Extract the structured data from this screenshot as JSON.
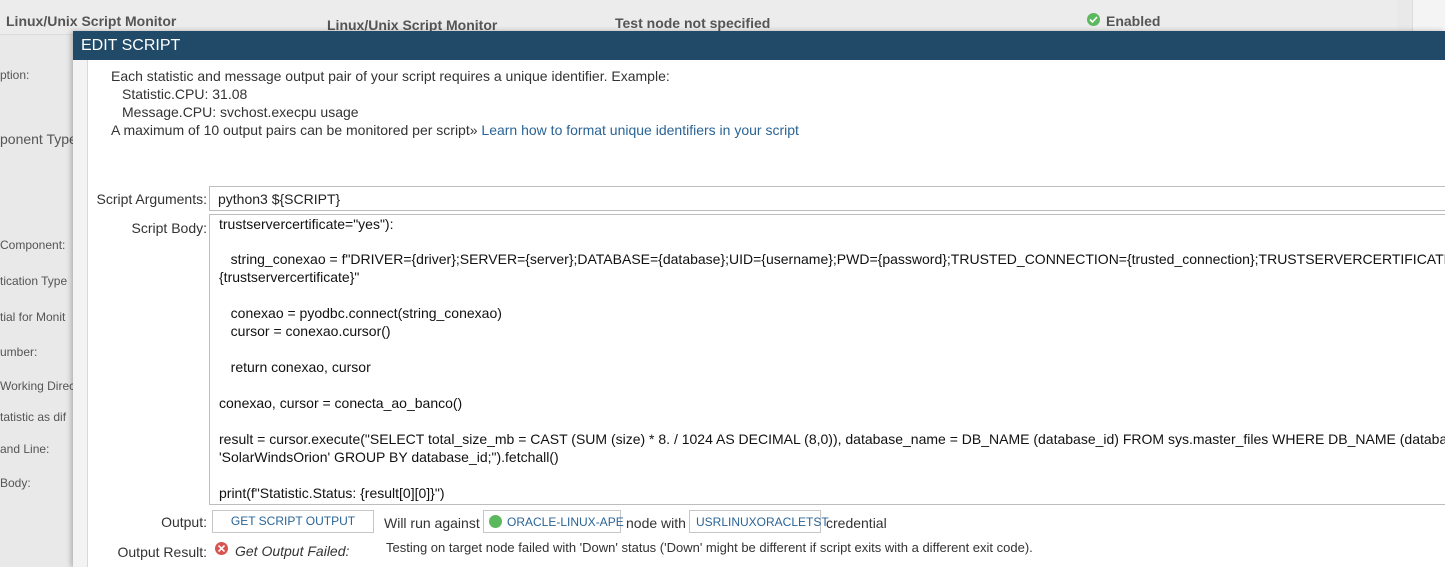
{
  "background": {
    "row": {
      "name": "Linux/Unix Script Monitor",
      "type": "Linux/Unix Script Monitor",
      "test_node": "Test node not specified",
      "status": "Enabled"
    },
    "labels": [
      "ption:",
      "ponent Type:",
      "Component:",
      "tication Type",
      "tial for Monit",
      "umber:",
      "Working Direc",
      "tatistic as dif",
      "and Line:",
      "Body:"
    ]
  },
  "modal": {
    "title": "EDIT SCRIPT",
    "info": {
      "line1": "Each statistic and message output pair of your script requires a unique identifier. Example:",
      "line2": "Statistic.CPU: 31.08",
      "line3": "Message.CPU: svchost.execpu usage",
      "line4": "A maximum of 10 output pairs can be monitored per script»",
      "link": "Learn how to format unique identifiers in your script"
    },
    "script_arguments_label": "Script Arguments:",
    "script_arguments_value": "python3 ${SCRIPT}",
    "script_body_label": "Script Body:",
    "script_body_lines": [
      "trustservercertificate=\"yes\"):",
      "",
      "   string_conexao = f\"DRIVER={driver};SERVER={server};DATABASE={database};UID={username};PWD={password};TRUSTED_CONNECTION={trusted_connection};TRUSTSERVERCERTIFICATE=",
      "{trustservercertificate}\"",
      "",
      "   conexao = pyodbc.connect(string_conexao)",
      "   cursor = conexao.cursor()",
      "",
      "   return conexao, cursor",
      "",
      "conexao, cursor = conecta_ao_banco()",
      "",
      "result = cursor.execute(\"SELECT total_size_mb = CAST (SUM (size) * 8. / 1024 AS DECIMAL (8,0)), database_name = DB_NAME (database_id) FROM sys.master_files WHERE DB_NAME (database_id) =",
      "'SolarWindsOrion' GROUP BY database_id;\").fetchall()",
      "",
      "print(f\"Statistic.Status: {result[0][0]}\")"
    ],
    "output_label": "Output:",
    "get_output_button": "GET SCRIPT OUTPUT",
    "will_run_against": "Will run against",
    "node_name": "ORACLE-LINUX-APE",
    "node_with": "node with",
    "credential_name": "USRLINUXORACLETST",
    "credential_suffix": "credential",
    "output_result_label": "Output Result:",
    "output_result_status": "Get Output Failed:",
    "output_result_message": "Testing on target node failed with 'Down' status ('Down' might be different if script exits with a different exit code).",
    "colors": {
      "header": "#204a68",
      "link": "#2a6496",
      "success": "#5cb85c",
      "error": "#d9534f"
    }
  }
}
